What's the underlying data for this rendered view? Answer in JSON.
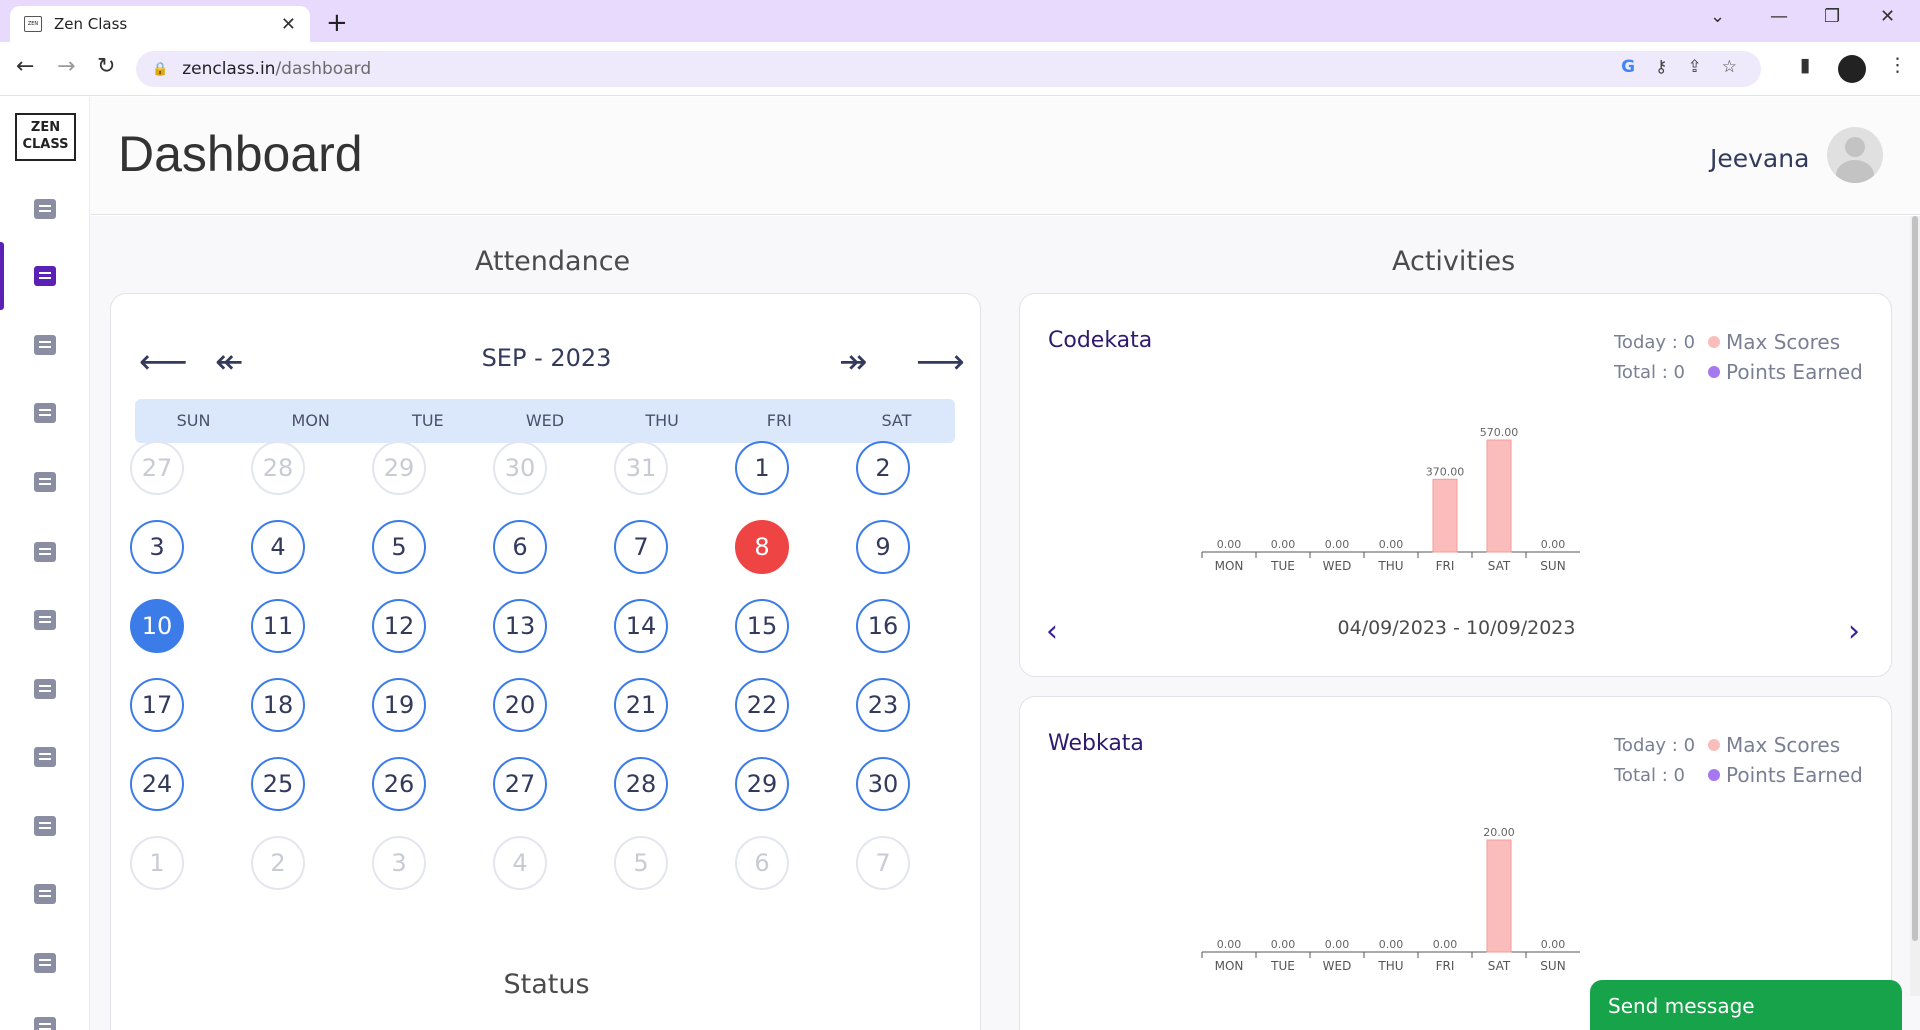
{
  "browser": {
    "tab_title": "Zen Class",
    "url_host": "zenclass.in",
    "url_path": "/dashboard"
  },
  "sidebar": {
    "logo_line1": "ZEN",
    "logo_line2": "CLASS",
    "items": [
      {
        "icon": "profile-icon"
      },
      {
        "icon": "dashboard-icon",
        "active": true
      },
      {
        "icon": "task-icon"
      },
      {
        "icon": "task-icon"
      },
      {
        "icon": "task-icon"
      },
      {
        "icon": "query-icon"
      },
      {
        "icon": "add-task-icon"
      },
      {
        "icon": "task-icon"
      },
      {
        "icon": "calendar-task-icon"
      },
      {
        "icon": "task-icon"
      },
      {
        "icon": "task-icon"
      },
      {
        "icon": "document-icon"
      },
      {
        "icon": "task-icon"
      }
    ]
  },
  "header": {
    "title": "Dashboard",
    "user_name": "Jeevana"
  },
  "attendance": {
    "title": "Attendance",
    "month_label": "SEP - 2023",
    "nav_prev": "⟵",
    "nav_prev_fast": "↞",
    "nav_next_fast": "↠",
    "nav_next": "⟶",
    "weekdays": [
      "SUN",
      "MON",
      "TUE",
      "WED",
      "THU",
      "FRI",
      "SAT"
    ],
    "weeks": [
      [
        {
          "d": "27",
          "s": "muted"
        },
        {
          "d": "28",
          "s": "muted"
        },
        {
          "d": "29",
          "s": "muted"
        },
        {
          "d": "30",
          "s": "muted"
        },
        {
          "d": "31",
          "s": "muted"
        },
        {
          "d": "1",
          "s": ""
        },
        {
          "d": "2",
          "s": ""
        }
      ],
      [
        {
          "d": "3",
          "s": ""
        },
        {
          "d": "4",
          "s": ""
        },
        {
          "d": "5",
          "s": ""
        },
        {
          "d": "6",
          "s": ""
        },
        {
          "d": "7",
          "s": ""
        },
        {
          "d": "8",
          "s": "absent"
        },
        {
          "d": "9",
          "s": ""
        }
      ],
      [
        {
          "d": "10",
          "s": "today"
        },
        {
          "d": "11",
          "s": ""
        },
        {
          "d": "12",
          "s": ""
        },
        {
          "d": "13",
          "s": ""
        },
        {
          "d": "14",
          "s": ""
        },
        {
          "d": "15",
          "s": ""
        },
        {
          "d": "16",
          "s": ""
        }
      ],
      [
        {
          "d": "17",
          "s": ""
        },
        {
          "d": "18",
          "s": ""
        },
        {
          "d": "19",
          "s": ""
        },
        {
          "d": "20",
          "s": ""
        },
        {
          "d": "21",
          "s": ""
        },
        {
          "d": "22",
          "s": ""
        },
        {
          "d": "23",
          "s": ""
        }
      ],
      [
        {
          "d": "24",
          "s": ""
        },
        {
          "d": "25",
          "s": ""
        },
        {
          "d": "26",
          "s": ""
        },
        {
          "d": "27",
          "s": ""
        },
        {
          "d": "28",
          "s": ""
        },
        {
          "d": "29",
          "s": ""
        },
        {
          "d": "30",
          "s": ""
        }
      ],
      [
        {
          "d": "1",
          "s": "muted"
        },
        {
          "d": "2",
          "s": "muted"
        },
        {
          "d": "3",
          "s": "muted"
        },
        {
          "d": "4",
          "s": "muted"
        },
        {
          "d": "5",
          "s": "muted"
        },
        {
          "d": "6",
          "s": "muted"
        },
        {
          "d": "7",
          "s": "muted"
        }
      ]
    ],
    "status_title": "Status"
  },
  "activities": {
    "title": "Activities",
    "codekata": {
      "name": "Codekata",
      "today": "Today : 0",
      "total": "Total : 0",
      "legend_max": "Max Scores",
      "legend_points": "Points Earned",
      "week_range": "04/09/2023 - 10/09/2023"
    },
    "webkata": {
      "name": "Webkata",
      "today": "Today : 0",
      "total": "Total : 0",
      "legend_max": "Max Scores",
      "legend_points": "Points Earned"
    }
  },
  "colors": {
    "max_scores": "#fbbcbc",
    "points_earned": "#a678f0",
    "accent": "#5b21b6",
    "present_border": "#3b7ce8",
    "absent": "#ef4444"
  },
  "chat": {
    "send_message": "Send message"
  },
  "chart_data": [
    {
      "type": "bar",
      "categories": [
        "MON",
        "TUE",
        "WED",
        "THU",
        "FRI",
        "SAT",
        "SUN"
      ],
      "series": [
        {
          "name": "Max Scores",
          "values": [
            0,
            0,
            0,
            0,
            370,
            570,
            0
          ]
        }
      ],
      "data_labels": [
        "0.00",
        "0.00",
        "0.00",
        "0.00",
        "370.00",
        "570.00",
        "0.00"
      ],
      "ylim": [
        0,
        570
      ]
    },
    {
      "type": "bar",
      "categories": [
        "MON",
        "TUE",
        "WED",
        "THU",
        "FRI",
        "SAT",
        "SUN"
      ],
      "series": [
        {
          "name": "Max Scores",
          "values": [
            0,
            0,
            0,
            0,
            0,
            20,
            0
          ]
        }
      ],
      "data_labels": [
        "0.00",
        "0.00",
        "0.00",
        "0.00",
        "0.00",
        "20.00",
        "0.00"
      ],
      "ylim": [
        0,
        20
      ]
    }
  ]
}
